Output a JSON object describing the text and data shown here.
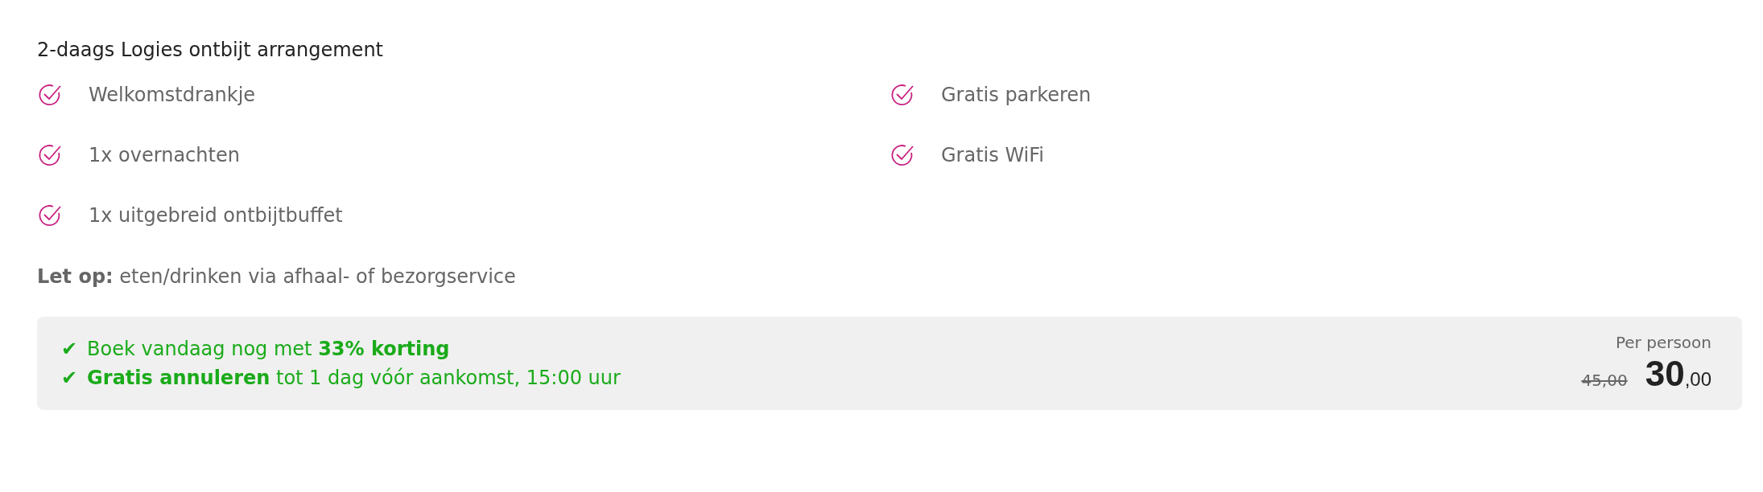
{
  "title": "2-daags Logies ontbijt arrangement",
  "feature_columns": [
    {
      "items": [
        "Welkomstdrankje",
        "1x overnachten",
        "1x uitgebreid ontbijtbuffet"
      ]
    },
    {
      "items": [
        "Gratis parkeren",
        "Gratis WiFi"
      ]
    }
  ],
  "note": "**Let op:** eten/drinken via afhaal- of bezorgservice",
  "offer": {
    "benefits": [
      {
        "mark": "✔",
        "text": "Boek vandaag nog met **33% korting**"
      },
      {
        "mark": "✔",
        "text": "**Gratis annuleren** tot 1 dag vóór aankomst, 15:00 uur"
      }
    ],
    "price_label": "Per persoon",
    "old_price": "45,00",
    "price_whole": "30",
    "price_cents": ",00"
  }
}
